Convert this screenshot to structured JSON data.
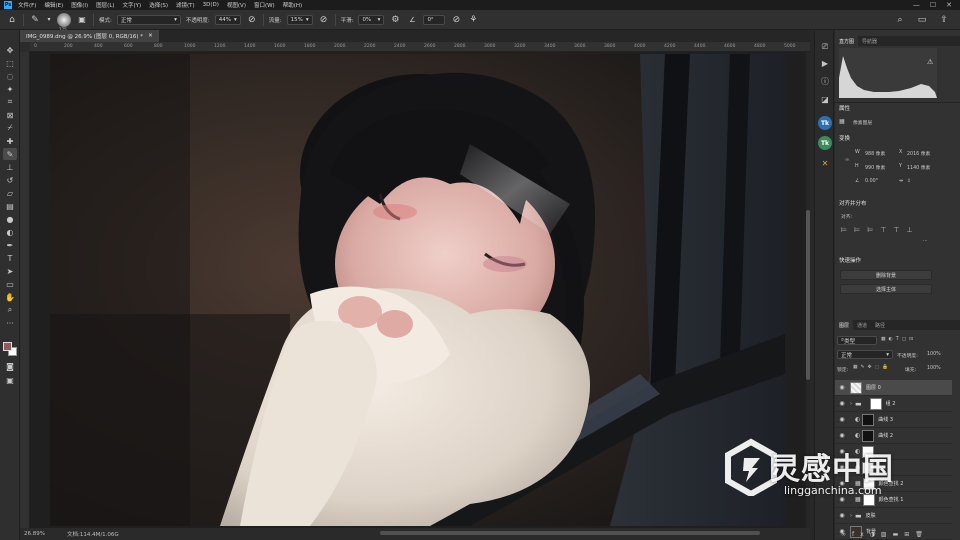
{
  "menubar": {
    "items": [
      "文件(F)",
      "编辑(E)",
      "图像(I)",
      "图层(L)",
      "文字(Y)",
      "选择(S)",
      "滤镜(T)",
      "3D(D)",
      "视图(V)",
      "窗口(W)",
      "帮助(H)"
    ],
    "window_controls": [
      "—",
      "☐",
      "✕"
    ]
  },
  "options": {
    "brush_size": "175",
    "mode_label": "模式:",
    "mode_value": "正常",
    "opacity_label": "不透明度:",
    "opacity_value": "44%",
    "flow_label": "流量:",
    "flow_value": "15%",
    "smooth_label": "平滑:",
    "smooth_value": "0%",
    "angle_value": "0°"
  },
  "document": {
    "tab_title": "IMG_0989.dng @ 26.9% (图层 0, RGB/16) *",
    "ruler_ticks": [
      "0",
      "200",
      "400",
      "600",
      "800",
      "1000",
      "1200",
      "1400",
      "1600",
      "1800",
      "2000",
      "2200",
      "2400",
      "2600",
      "2800",
      "3000",
      "3200",
      "3400",
      "3600",
      "3800",
      "4000",
      "4200",
      "4400",
      "4600",
      "4800",
      "5000"
    ]
  },
  "statusbar": {
    "zoom": "26.89%",
    "doc_size": "文档:114.4M/1.06G"
  },
  "panels": {
    "histogram_tabs": [
      "直方图",
      "导航器"
    ],
    "properties_title": "属性",
    "pixel_layer": "像素图层",
    "transform_title": "变换",
    "w_label": "W",
    "w_value": "988 像素",
    "x_label": "X",
    "x_value": "2016 像素",
    "h_label": "H",
    "h_value": "990 像素",
    "y_label": "Y",
    "y_value": "1140 像素",
    "angle_value": "0.00°",
    "align_title": "对齐并分布",
    "align_sub": "对齐:",
    "quick_actions_title": "快速操作",
    "remove_bg_button": "删除背景",
    "select_subject_button": "选择主体",
    "layers_tabs": [
      "图层",
      "通道",
      "路径"
    ],
    "kind_filter": "类型",
    "blend_mode": "正常",
    "opacity_label": "不透明度:",
    "opacity_value": "100%",
    "lock_label": "锁定:",
    "fill_label": "填充:",
    "fill_value": "100%"
  },
  "layers": [
    {
      "name": "图层 0",
      "type": "pixel",
      "selected": true
    },
    {
      "name": "组 2",
      "type": "group",
      "selected": false
    },
    {
      "name": "曲线 3",
      "type": "adjustment",
      "selected": false
    },
    {
      "name": "曲线 2",
      "type": "adjustment",
      "selected": false
    },
    {
      "name": "",
      "type": "adjustment",
      "selected": false
    },
    {
      "name": "",
      "type": "adjustment",
      "selected": false
    },
    {
      "name": "颜色查找 2",
      "type": "adjustment",
      "selected": false
    },
    {
      "name": "颜色查找 1",
      "type": "adjustment",
      "selected": false
    },
    {
      "name": "皮肤",
      "type": "group",
      "selected": false
    },
    {
      "name": "背景",
      "type": "pixel",
      "selected": false
    }
  ],
  "watermark": {
    "title": "灵感中国",
    "url": "lingganchina.com"
  },
  "colors": {
    "foreground": "#8f5b61",
    "background": "#ffffff",
    "accent": "#31a8ff"
  },
  "icons": {
    "tools": [
      "move-icon",
      "marquee-icon",
      "lasso-icon",
      "quick-select-icon",
      "crop-icon",
      "frame-icon",
      "eyedropper-icon",
      "healing-icon",
      "brush-icon",
      "stamp-icon",
      "history-brush-icon",
      "eraser-icon",
      "gradient-icon",
      "blur-icon",
      "dodge-icon",
      "pen-icon",
      "type-icon",
      "path-select-icon",
      "shape-icon",
      "hand-icon",
      "zoom-icon",
      "more-icon"
    ]
  }
}
